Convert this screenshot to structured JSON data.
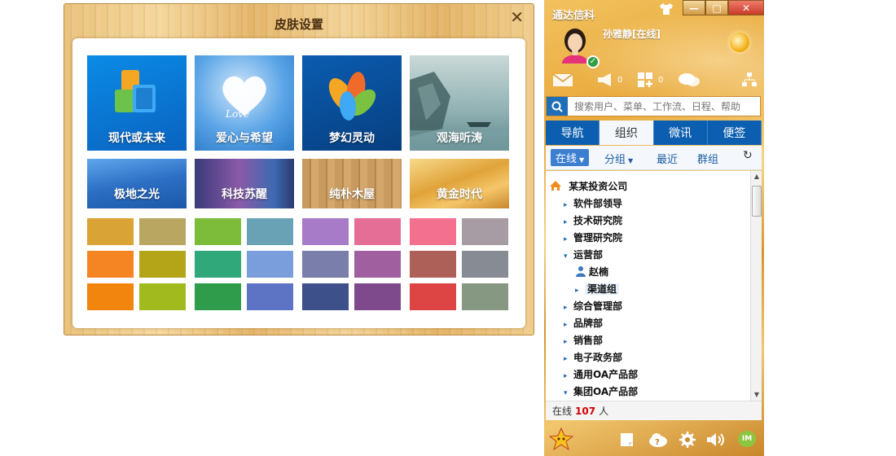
{
  "dialog": {
    "title": "皮肤设置",
    "close_glyph": "✕",
    "themes": [
      {
        "label": "现代或未来",
        "color": "#0f7fd8"
      },
      {
        "label": "爱心与希望",
        "color": "#3a8fd6"
      },
      {
        "label": "梦幻灵动",
        "color": "#0d4f9c"
      },
      {
        "label": "观海听涛",
        "color": "#8fb2b5"
      },
      {
        "label": "极地之光",
        "color": "#2f6fc0"
      },
      {
        "label": "科技苏醒",
        "color": "#5a4a8a"
      },
      {
        "label": "纯朴木屋",
        "color": "#b98950"
      },
      {
        "label": "黄金时代",
        "color": "#e0a33a"
      }
    ],
    "swatches": [
      "#d9a336",
      "#b9a660",
      "#7cbc3a",
      "#6aa2b5",
      "#a77bc7",
      "#e46e95",
      "#f3708f",
      "#a79ca3",
      "#f58523",
      "#b3a418",
      "#31a87a",
      "#7a9ddc",
      "#7a7eab",
      "#a05f9e",
      "#ad6058",
      "#868b94",
      "#f1850e",
      "#a1bb1e",
      "#2f9c4c",
      "#5d73c3",
      "#3d508a",
      "#7f4a8b",
      "#dd4545",
      "#869882"
    ]
  },
  "im": {
    "title": "通达信科",
    "user": "孙雅静[在线]",
    "window_buttons": {
      "minimize": "—",
      "maximize": "□",
      "close": "✕"
    },
    "tools": {
      "messages": "",
      "notices": "0",
      "apps": "0"
    },
    "search": {
      "placeholder": "搜索用户、菜单、工作流、日程、帮助"
    },
    "tabs": [
      "导航",
      "组织",
      "微讯",
      "便签"
    ],
    "subtabs": {
      "online": "在线",
      "group": "分组",
      "recent": "最近",
      "groups": "群组"
    },
    "tree": {
      "company": "某某投资公司",
      "items": [
        {
          "label": "软件部领导",
          "level": 1,
          "state": "collapsed"
        },
        {
          "label": "技术研究院",
          "level": 1,
          "state": "collapsed"
        },
        {
          "label": "管理研究院",
          "level": 1,
          "state": "collapsed"
        },
        {
          "label": "运营部",
          "level": 1,
          "state": "expanded"
        },
        {
          "label": "赵楠",
          "level": 2,
          "state": "user"
        },
        {
          "label": "渠道组",
          "level": 2,
          "state": "selected"
        },
        {
          "label": "综合管理部",
          "level": 1,
          "state": "collapsed"
        },
        {
          "label": "品牌部",
          "level": 1,
          "state": "collapsed"
        },
        {
          "label": "销售部",
          "level": 1,
          "state": "collapsed"
        },
        {
          "label": "电子政务部",
          "level": 1,
          "state": "collapsed"
        },
        {
          "label": "通用OA产品部",
          "level": 1,
          "state": "collapsed"
        },
        {
          "label": "集团OA产品部",
          "level": 1,
          "state": "expanded"
        }
      ]
    },
    "online": {
      "prefix": "在线",
      "count": "107",
      "suffix": "人"
    },
    "bottom_tools": {
      "im_badge": "IM"
    }
  }
}
